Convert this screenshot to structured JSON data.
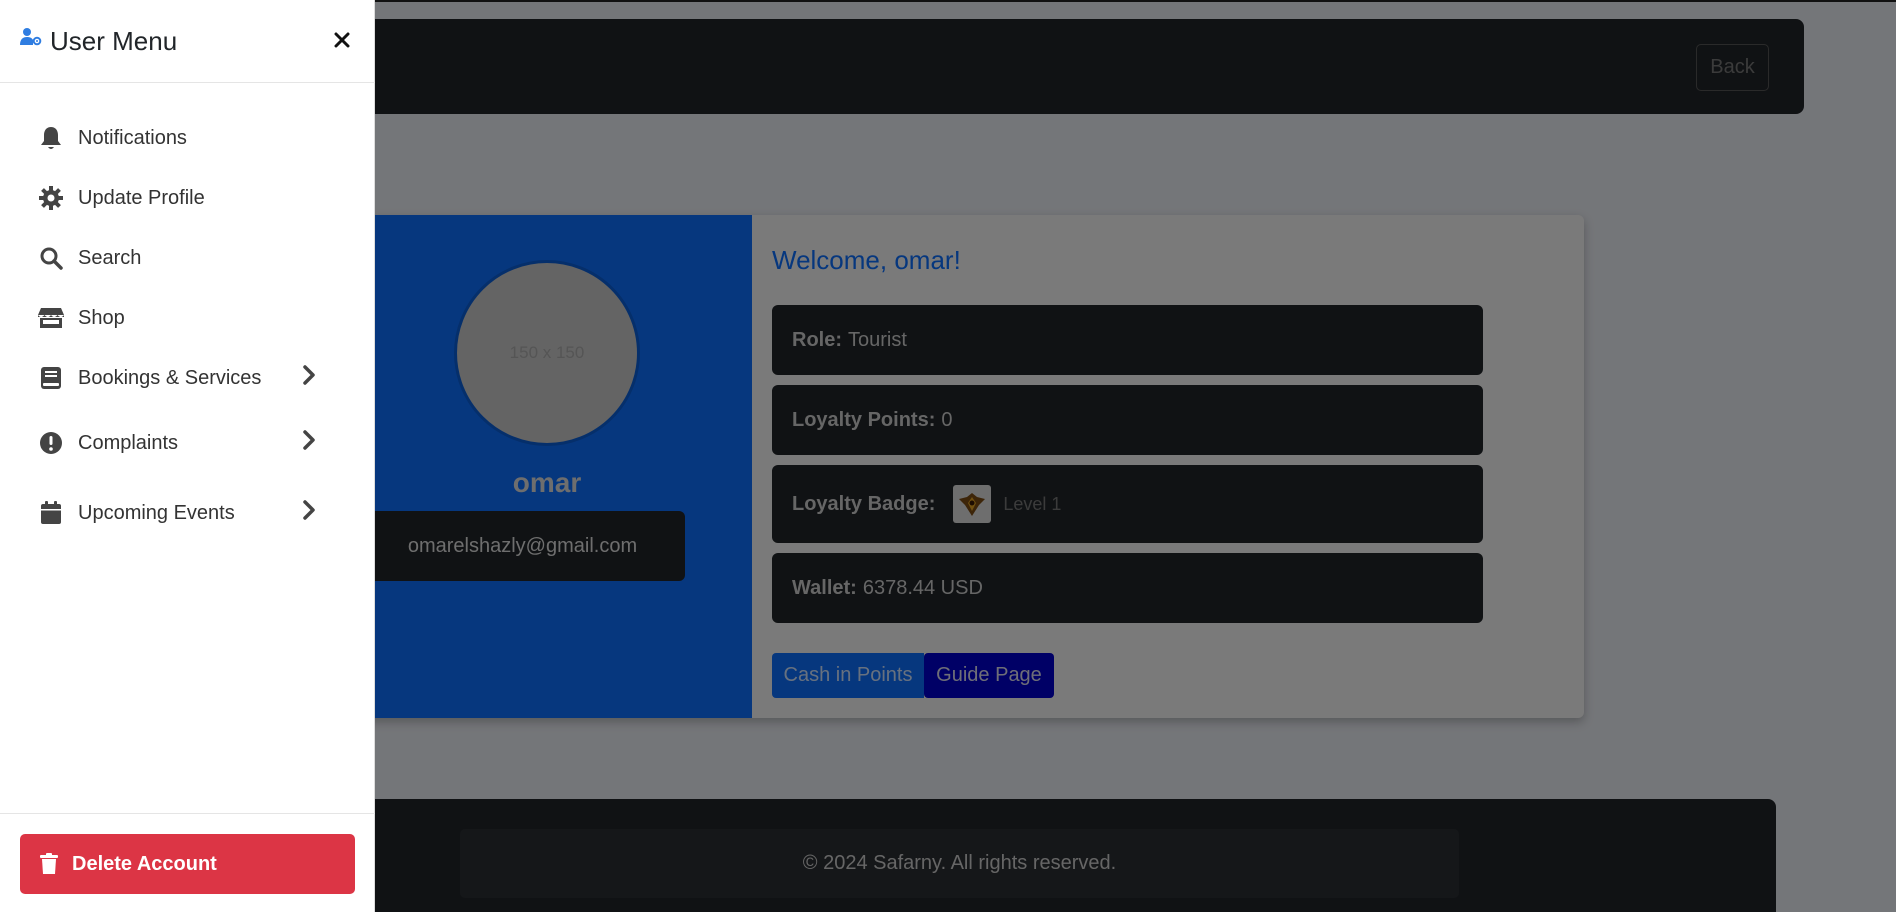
{
  "navbar": {
    "back_label": "Back"
  },
  "profile": {
    "avatar_placeholder": "150 x 150",
    "username": "omar",
    "email": "omarelshazly@gmail.com",
    "welcome": "Welcome, omar!",
    "role_label": "Role:",
    "role_value": "Tourist",
    "points_label": "Loyalty Points:",
    "points_value": "0",
    "badge_label": "Loyalty Badge:",
    "badge_level": "Level 1",
    "wallet_label": "Wallet:",
    "wallet_value": "6378.44 USD",
    "cash_in_label": "Cash in Points",
    "guide_label": "Guide Page"
  },
  "footer": {
    "copyright": "© 2024 Safarny. All rights reserved."
  },
  "user_menu": {
    "title": "User Menu",
    "items": [
      {
        "label": "Notifications",
        "icon": "bell-icon"
      },
      {
        "label": "Update Profile",
        "icon": "gear-icon"
      },
      {
        "label": "Search",
        "icon": "search-icon"
      },
      {
        "label": "Shop",
        "icon": "store-icon"
      },
      {
        "label": "Bookings & Services",
        "icon": "book-icon",
        "has_submenu": true
      },
      {
        "label": "Complaints",
        "icon": "exclamation-circle-icon",
        "has_submenu": true
      },
      {
        "label": "Upcoming Events",
        "icon": "calendar-icon",
        "has_submenu": true
      }
    ],
    "delete_label": "Delete Account"
  },
  "colors": {
    "primary": "#0d6efd",
    "danger": "#dc3545",
    "dark": "#212529",
    "guide_button": "#0000cc"
  }
}
